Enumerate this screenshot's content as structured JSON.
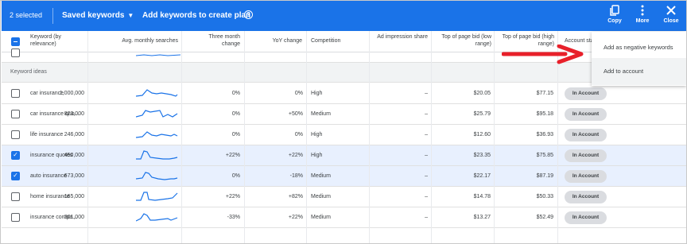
{
  "toolbar": {
    "selected": "2 selected",
    "saved_keywords": "Saved keywords",
    "add_keywords": "Add keywords to create plan",
    "help": "?",
    "copy": "Copy",
    "more": "More",
    "close": "Close"
  },
  "columns": {
    "keyword": "Keyword (by relevance)",
    "avg": "Avg. monthly searches",
    "three_month": "Three month change",
    "yoy": "YoY change",
    "competition": "Competition",
    "impression": "Ad impression share",
    "bid_low": "Top of page bid (low range)",
    "bid_high": "Top of page bid (high range)",
    "account_status": "Account sta..."
  },
  "section_label": "Keyword ideas",
  "rows": [
    {
      "keyword": "car insurance",
      "avg": "1,000,000",
      "three": "0%",
      "yoy": "0%",
      "comp": "High",
      "imp": "–",
      "low": "$20.05",
      "high": "$77.15",
      "status": "In Account",
      "checked": false
    },
    {
      "keyword": "car insurance quo...",
      "avg": "823,000",
      "three": "0%",
      "yoy": "+50%",
      "comp": "Medium",
      "imp": "–",
      "low": "$25.79",
      "high": "$95.18",
      "status": "In Account",
      "checked": false
    },
    {
      "keyword": "life insurance",
      "avg": "246,000",
      "three": "0%",
      "yoy": "0%",
      "comp": "High",
      "imp": "–",
      "low": "$12.60",
      "high": "$36.93",
      "status": "In Account",
      "checked": false
    },
    {
      "keyword": "insurance quotes",
      "avg": "450,000",
      "three": "+22%",
      "yoy": "+22%",
      "comp": "High",
      "imp": "–",
      "low": "$23.35",
      "high": "$75.85",
      "status": "In Account",
      "checked": true
    },
    {
      "keyword": "auto insurance",
      "avg": "673,000",
      "three": "0%",
      "yoy": "-18%",
      "comp": "Medium",
      "imp": "–",
      "low": "$22.17",
      "high": "$87.19",
      "status": "In Account",
      "checked": true
    },
    {
      "keyword": "home insurance",
      "avg": "165,000",
      "three": "+22%",
      "yoy": "+82%",
      "comp": "Medium",
      "imp": "–",
      "low": "$14.78",
      "high": "$50.33",
      "status": "In Account",
      "checked": false
    },
    {
      "keyword": "insurance compa...",
      "avg": "301,000",
      "three": "-33%",
      "yoy": "+22%",
      "comp": "Medium",
      "imp": "–",
      "low": "$13.27",
      "high": "$52.49",
      "status": "In Account",
      "checked": false
    }
  ],
  "menu": {
    "item1": "Add as negative keywords",
    "item2": "Add to account"
  },
  "colors": {
    "accent": "#1a73e8",
    "arrow": "#e8202a",
    "selected_row": "#e8f0fe"
  },
  "icons": {
    "copy": "copy-icon",
    "more": "more-vert-icon",
    "close": "close-icon"
  }
}
